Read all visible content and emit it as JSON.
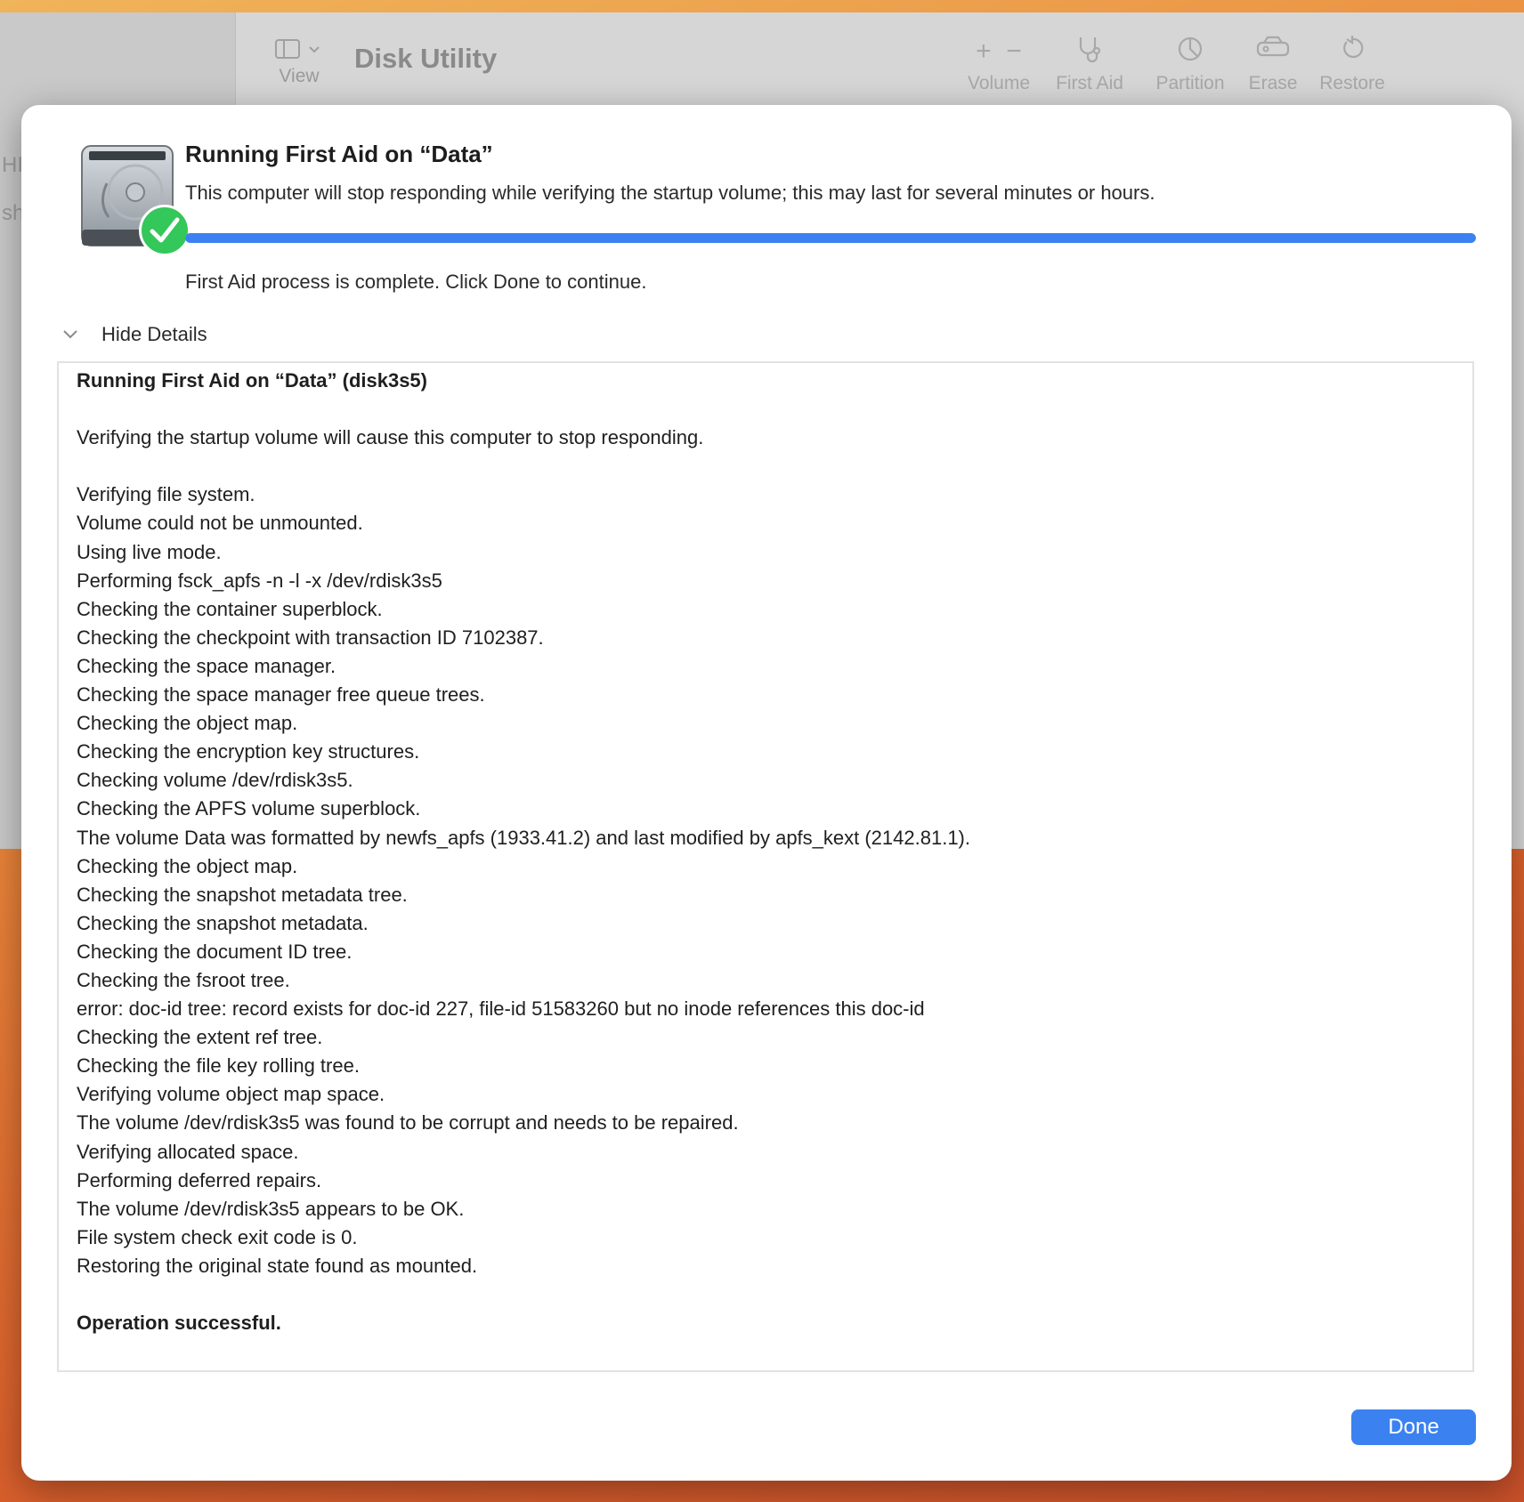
{
  "background_window": {
    "app_title": "Disk Utility",
    "toolbar": {
      "view_label": "View",
      "volume_label": "Volume",
      "first_aid_label": "First Aid",
      "partition_label": "Partition",
      "erase_label": "Erase",
      "restore_label": "Restore"
    }
  },
  "dialog": {
    "title": "Running First Aid on “Data”",
    "subtitle": "This computer will stop responding while verifying the startup volume; this may last for several minutes or hours.",
    "progress": 1.0,
    "status": "First Aid process is complete. Click Done to continue.",
    "details_toggle_label": "Hide Details",
    "log_lines": [
      {
        "text": "Running First Aid on “Data” (disk3s5)",
        "bold": true
      },
      {
        "text": "",
        "bold": false
      },
      {
        "text": "Verifying the startup volume will cause this computer to stop responding.",
        "bold": false
      },
      {
        "text": "",
        "bold": false
      },
      {
        "text": "Verifying file system.",
        "bold": false
      },
      {
        "text": "Volume could not be unmounted.",
        "bold": false
      },
      {
        "text": "Using live mode.",
        "bold": false
      },
      {
        "text": "Performing fsck_apfs -n -l -x /dev/rdisk3s5",
        "bold": false
      },
      {
        "text": "Checking the container superblock.",
        "bold": false
      },
      {
        "text": "Checking the checkpoint with transaction ID 7102387.",
        "bold": false
      },
      {
        "text": "Checking the space manager.",
        "bold": false
      },
      {
        "text": "Checking the space manager free queue trees.",
        "bold": false
      },
      {
        "text": "Checking the object map.",
        "bold": false
      },
      {
        "text": "Checking the encryption key structures.",
        "bold": false
      },
      {
        "text": "Checking volume /dev/rdisk3s5.",
        "bold": false
      },
      {
        "text": "Checking the APFS volume superblock.",
        "bold": false
      },
      {
        "text": "The volume Data was formatted by newfs_apfs (1933.41.2) and last modified by apfs_kext (2142.81.1).",
        "bold": false
      },
      {
        "text": "Checking the object map.",
        "bold": false
      },
      {
        "text": "Checking the snapshot metadata tree.",
        "bold": false
      },
      {
        "text": "Checking the snapshot metadata.",
        "bold": false
      },
      {
        "text": "Checking the document ID tree.",
        "bold": false
      },
      {
        "text": "Checking the fsroot tree.",
        "bold": false
      },
      {
        "text": "error: doc-id tree: record exists for doc-id 227, file-id 51583260 but no inode references this doc-id",
        "bold": false
      },
      {
        "text": "Checking the extent ref tree.",
        "bold": false
      },
      {
        "text": "Checking the file key rolling tree.",
        "bold": false
      },
      {
        "text": "Verifying volume object map space.",
        "bold": false
      },
      {
        "text": "The volume /dev/rdisk3s5 was found to be corrupt and needs to be repaired.",
        "bold": false
      },
      {
        "text": "Verifying allocated space.",
        "bold": false
      },
      {
        "text": "Performing deferred repairs.",
        "bold": false
      },
      {
        "text": "The volume /dev/rdisk3s5 appears to be OK.",
        "bold": false
      },
      {
        "text": "File system check exit code is 0.",
        "bold": false
      },
      {
        "text": "Restoring the original state found as mounted.",
        "bold": false
      },
      {
        "text": "",
        "bold": false
      },
      {
        "text": "Operation successful.",
        "bold": true
      }
    ],
    "done_label": "Done"
  },
  "colors": {
    "accent": "#3b82f0",
    "success_check": "#34c759"
  },
  "icons": {
    "disk": "internal-disk-icon",
    "badge": "checkmark-badge-icon",
    "disclosure": "chevron-down-icon"
  }
}
